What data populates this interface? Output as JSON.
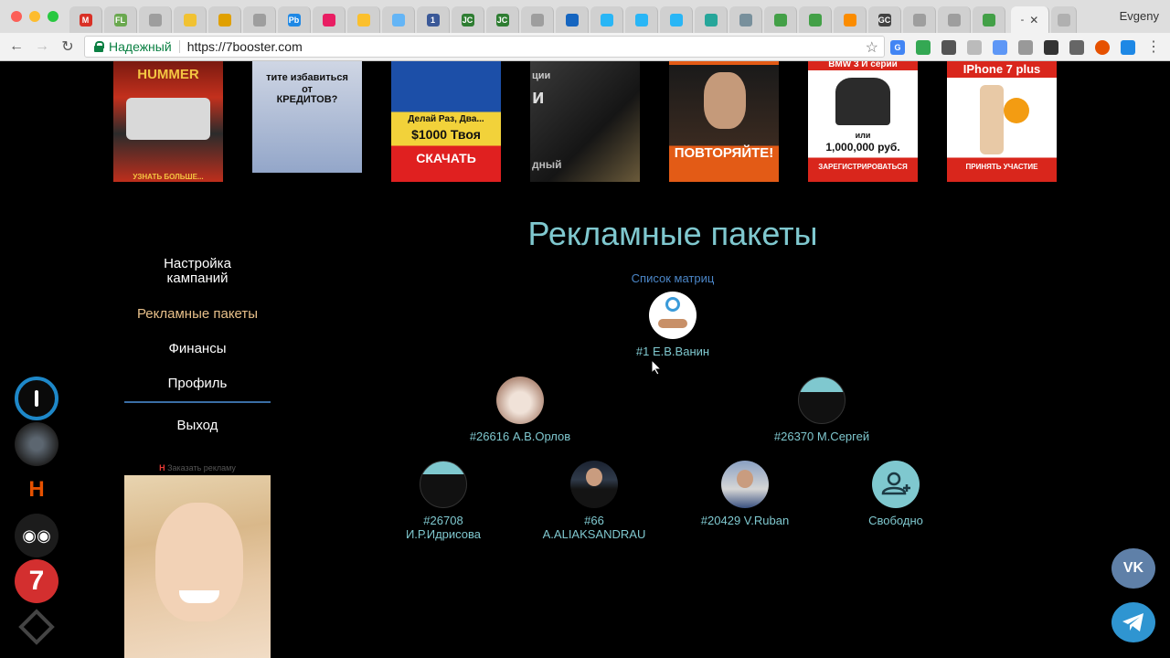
{
  "browser": {
    "user_name": "Evgeny",
    "active_tab_label": "-",
    "secure_label": "Надежный",
    "url": "https://7booster.com",
    "tab_favicons": [
      {
        "icon": "gmail-icon",
        "text": "M",
        "color": "#d93025"
      },
      {
        "icon": "fl-icon",
        "text": "FL",
        "color": "#6aa84f"
      },
      {
        "icon": "page-icon",
        "text": "",
        "color": "#9e9e9e"
      },
      {
        "icon": "yellow-icon",
        "text": "",
        "color": "#f1c232"
      },
      {
        "icon": "doc-icon",
        "text": "",
        "color": "#e0a000"
      },
      {
        "icon": "page-icon",
        "text": "",
        "color": "#9e9e9e"
      },
      {
        "icon": "pb-icon",
        "text": "Pb",
        "color": "#1e88e5"
      },
      {
        "icon": "red-icon",
        "text": "",
        "color": "#e91e63"
      },
      {
        "icon": "shop-icon",
        "text": "",
        "color": "#fbc02d"
      },
      {
        "icon": "cloud-icon",
        "text": "",
        "color": "#64b5f6"
      },
      {
        "icon": "one-icon",
        "text": "1",
        "color": "#3b5998"
      },
      {
        "icon": "jc-icon",
        "text": "JC",
        "color": "#2e7d32"
      },
      {
        "icon": "jc-icon",
        "text": "JC",
        "color": "#2e7d32"
      },
      {
        "icon": "page-icon",
        "text": "",
        "color": "#9e9e9e"
      },
      {
        "icon": "diamond-icon",
        "text": "",
        "color": "#1565c0"
      },
      {
        "icon": "circle-icon",
        "text": "",
        "color": "#29b6f6"
      },
      {
        "icon": "circle-icon",
        "text": "",
        "color": "#29b6f6"
      },
      {
        "icon": "circle-icon",
        "text": "",
        "color": "#29b6f6"
      },
      {
        "icon": "plane-icon",
        "text": "",
        "color": "#26a69a"
      },
      {
        "icon": "globe-icon",
        "text": "",
        "color": "#78909c"
      },
      {
        "icon": "leaf-icon",
        "text": "",
        "color": "#43a047"
      },
      {
        "icon": "leaf-icon",
        "text": "",
        "color": "#43a047"
      },
      {
        "icon": "q-icon",
        "text": "",
        "color": "#fb8c00"
      },
      {
        "icon": "gc-icon",
        "text": "GC",
        "color": "#424242"
      },
      {
        "icon": "page-icon",
        "text": "",
        "color": "#9e9e9e"
      },
      {
        "icon": "page-icon",
        "text": "",
        "color": "#9e9e9e"
      },
      {
        "icon": "user-icon",
        "text": "",
        "color": "#43a047"
      }
    ]
  },
  "banners": [
    {
      "lines": [
        "HUMMER",
        "УЗНАТЬ БОЛЬШЕ..."
      ]
    },
    {
      "lines": [
        "тите избавиться",
        "от",
        "КРЕДИТОВ?"
      ]
    },
    {
      "lines": [
        "Делай Раз, Два...",
        "$1000 Твоя",
        "СКАЧАТЬ"
      ]
    },
    {
      "lines": [
        "ции",
        "и",
        "дный"
      ]
    },
    {
      "lines": [
        "ПОВТОРЯЙТЕ!"
      ]
    },
    {
      "lines": [
        "BMW 3 И серии",
        "или",
        "1,000,000 руб.",
        "ЗАРЕГИСТРИРОВАТЬСЯ"
      ]
    },
    {
      "lines": [
        "IPhone 7 plus",
        "ПРИНЯТЬ УЧАСТИЕ"
      ]
    }
  ],
  "page": {
    "title": "Рекламные пакеты",
    "matrix_list_link": "Список матриц"
  },
  "menu": {
    "items": [
      "Настройка кампаний",
      "Рекламные пакеты",
      "Финансы",
      "Профиль",
      "Выход"
    ],
    "active": "Рекламные пакеты",
    "order_ad": "Заказать рекламу"
  },
  "matrix": {
    "root": {
      "label": "#1 Е.В.Ванин",
      "avatar": "handshake"
    },
    "level1": [
      {
        "label": "#26616 А.В.Орлов",
        "avatar": "cat"
      },
      {
        "label": "#26370 М.Сергей",
        "avatar": "half-dark"
      }
    ],
    "level2": [
      {
        "label": "#26708 И.Р.Идрисова",
        "avatar": "half-dark"
      },
      {
        "label": "#66 A.ALIAKSANDRAU",
        "avatar": "suit"
      },
      {
        "label": "#20429 V.Ruban",
        "avatar": "person"
      },
      {
        "label": "Свободно",
        "avatar": "free"
      }
    ]
  },
  "side_icons": [
    {
      "name": "power-ring-icon",
      "color": "#1e88c9"
    },
    {
      "name": "globe-grid-icon",
      "color": "#444"
    },
    {
      "name": "h-logo-icon",
      "color": "#e65100"
    },
    {
      "name": "eyes-icon",
      "color": "#222"
    },
    {
      "name": "seven-logo-icon",
      "color": "#d32f2f"
    },
    {
      "name": "diamond-logo-icon",
      "color": "#333"
    }
  ],
  "social": {
    "vk_label": "VK",
    "vk_color": "#5f80a8",
    "telegram_color": "#2f95d1"
  }
}
